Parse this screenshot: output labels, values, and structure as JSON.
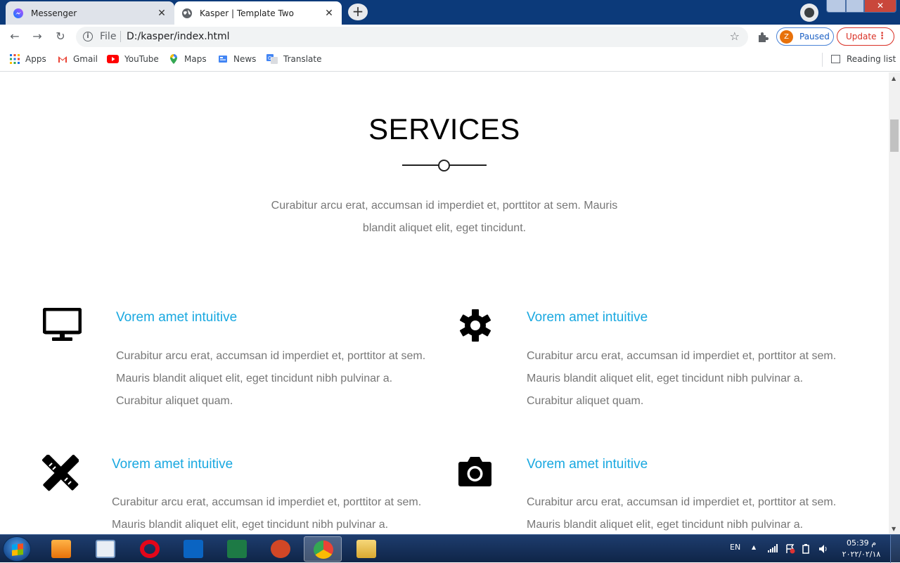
{
  "browser": {
    "tabs": [
      {
        "title": "Messenger",
        "favicon": "messenger-icon",
        "active": false
      },
      {
        "title": "Kasper | Template Two",
        "favicon": "globe-icon",
        "active": true
      }
    ],
    "address": {
      "scheme": "File",
      "url": "D:/kasper/index.html"
    },
    "profile": {
      "initial": "Z",
      "status": "Paused"
    },
    "update_label": "Update",
    "bookmarks": [
      {
        "label": "Apps",
        "icon": "apps-grid-icon"
      },
      {
        "label": "Gmail",
        "icon": "gmail-icon"
      },
      {
        "label": "YouTube",
        "icon": "youtube-icon"
      },
      {
        "label": "Maps",
        "icon": "maps-pin-icon"
      },
      {
        "label": "News",
        "icon": "news-icon"
      },
      {
        "label": "Translate",
        "icon": "translate-icon"
      }
    ],
    "reading_list": "Reading list"
  },
  "page": {
    "section_title": "SERVICES",
    "section_description": "Curabitur arcu erat, accumsan id imperdiet et, porttitor at sem. Mauris blandit aliquet elit, eget tincidunt.",
    "services": [
      {
        "icon": "desktop-monitor-icon",
        "title": "Vorem amet intuitive",
        "text": "Curabitur arcu erat, accumsan id imperdiet et, porttitor at sem. Mauris blandit aliquet elit, eget tincidunt nibh pulvinar a. Curabitur aliquet quam."
      },
      {
        "icon": "gear-icon",
        "title": "Vorem amet intuitive",
        "text": "Curabitur arcu erat, accumsan id imperdiet et, porttitor at sem. Mauris blandit aliquet elit, eget tincidunt nibh pulvinar a. Curabitur aliquet quam."
      },
      {
        "icon": "pencil-ruler-icon",
        "title": "Vorem amet intuitive",
        "text": "Curabitur arcu erat, accumsan id imperdiet et, porttitor at sem. Mauris blandit aliquet elit, eget tincidunt nibh pulvinar a. Curabitur aliquet quam."
      },
      {
        "icon": "camera-icon",
        "title": "Vorem amet intuitive",
        "text": "Curabitur arcu erat, accumsan id imperdiet et, porttitor at sem. Mauris blandit aliquet elit, eget tincidunt nibh pulvinar a. Curabitur aliquet quam."
      }
    ],
    "colors": {
      "heading": "#000000",
      "accent": "#19a8e0",
      "body_text": "#777777"
    }
  },
  "taskbar": {
    "apps": [
      "media-player-icon",
      "news-reader-icon",
      "opera-icon",
      "outlook-icon",
      "excel-icon",
      "powerpoint-icon",
      "chrome-icon",
      "file-explorer-icon"
    ],
    "active_app": "chrome-icon",
    "language": "EN",
    "time": "05:39 م",
    "date": "٢٠٢٢/٠٢/١٨"
  }
}
